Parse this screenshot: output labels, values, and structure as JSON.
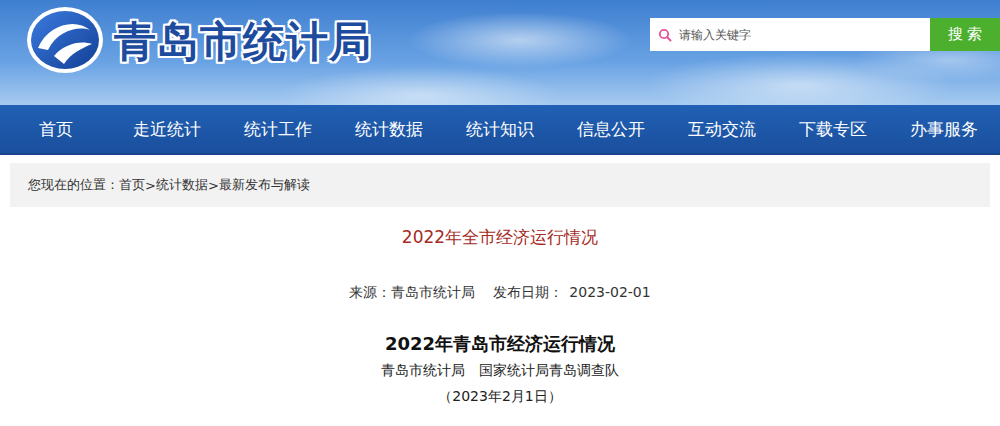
{
  "site": {
    "name": "青岛市统计局"
  },
  "search": {
    "placeholder": "请输入关键字",
    "button": "搜 索"
  },
  "nav": [
    "首页",
    "走近统计",
    "统计工作",
    "统计数据",
    "统计知识",
    "信息公开",
    "互动交流",
    "下载专区",
    "办事服务"
  ],
  "breadcrumb": {
    "label": "您现在的位置：",
    "separator": ">",
    "items": [
      "首页",
      "统计数据",
      "最新发布与解读"
    ]
  },
  "article": {
    "title": "2022年全市经济运行情况",
    "source_label": "来源：",
    "source": "青岛市统计局",
    "date_label": "发布日期：",
    "date": "2023-02-01",
    "heading": "2022年青岛市经济运行情况",
    "authors": [
      "青岛市统计局",
      "国家统计局青岛调查队"
    ],
    "date_line": "（2023年2月1日）"
  }
}
